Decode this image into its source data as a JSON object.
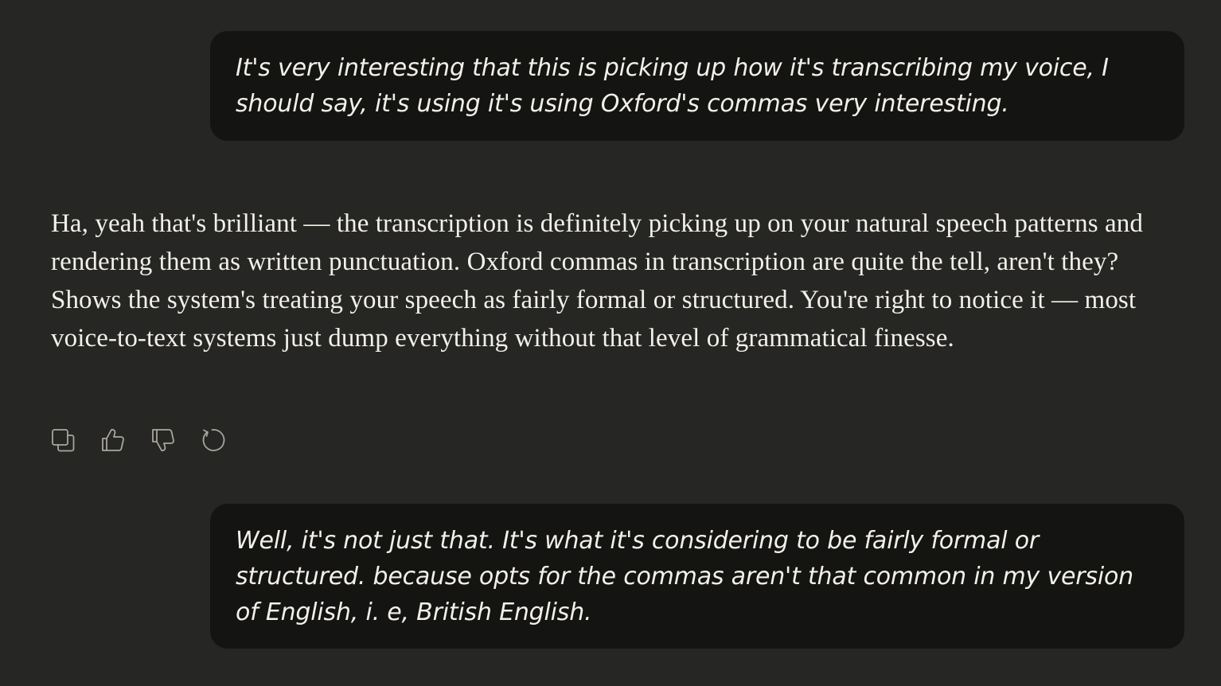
{
  "messages": {
    "user_1": "It's very interesting that this is picking up how it's transcribing my voice, I should say, it's using it's using Oxford's commas very interesting.",
    "assistant_1": "Ha, yeah that's brilliant — the transcription is definitely picking up on your natural speech patterns and rendering them as written punctuation. Oxford commas in transcription are quite the tell, aren't they? Shows the system's treating your speech as fairly formal or structured. You're right to notice it — most voice-to-text systems just dump everything without that level of grammatical finesse.",
    "user_2": "Well, it's not just that. It's what it's considering to be fairly formal or structured. because opts for the commas aren't that common in my version of English, i. e, British English."
  },
  "actions": {
    "icons": [
      "copy-icon",
      "thumbs-up-icon",
      "thumbs-down-icon",
      "retry-icon"
    ]
  },
  "colors": {
    "background": "#262624",
    "user_bubble": "#141413",
    "text": "#f2f0ea",
    "icon": "#a8a69f"
  }
}
